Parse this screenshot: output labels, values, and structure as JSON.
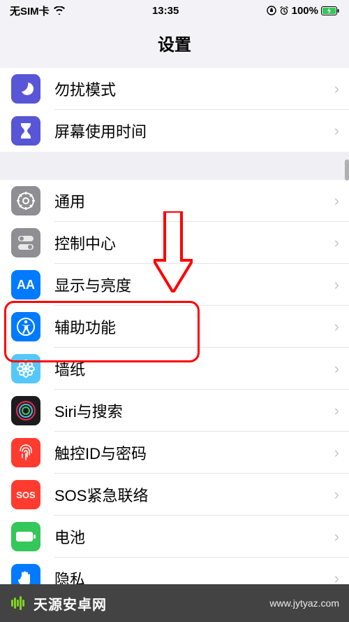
{
  "status": {
    "carrier": "无SIM卡",
    "time": "13:35",
    "battery": "100%"
  },
  "nav": {
    "title": "设置"
  },
  "section1": [
    {
      "label": "勿扰模式",
      "class": "ic-dnd",
      "name": "do-not-disturb"
    },
    {
      "label": "屏幕使用时间",
      "class": "ic-screentime",
      "name": "screen-time"
    }
  ],
  "section2": [
    {
      "label": "通用",
      "class": "ic-general",
      "name": "general"
    },
    {
      "label": "控制中心",
      "class": "ic-control",
      "name": "control-center"
    },
    {
      "label": "显示与亮度",
      "class": "ic-display",
      "name": "display-brightness"
    },
    {
      "label": "辅助功能",
      "class": "ic-accessibility",
      "name": "accessibility"
    },
    {
      "label": "墙纸",
      "class": "ic-wallpaper",
      "name": "wallpaper"
    },
    {
      "label": "Siri与搜索",
      "class": "ic-siri",
      "name": "siri-search"
    },
    {
      "label": "触控ID与密码",
      "class": "ic-touchid",
      "name": "touch-id-passcode"
    },
    {
      "label": "SOS紧急联络",
      "class": "ic-sos",
      "name": "sos-emergency"
    },
    {
      "label": "电池",
      "class": "ic-battery",
      "name": "battery"
    },
    {
      "label": "隐私",
      "class": "ic-privacy",
      "name": "privacy"
    }
  ],
  "watermark": {
    "title": "天源安卓网",
    "url": "www.jytyaz.com"
  },
  "annotation": {
    "highlighted_row": "accessibility"
  },
  "colors": {
    "highlight": "#ff0000"
  }
}
